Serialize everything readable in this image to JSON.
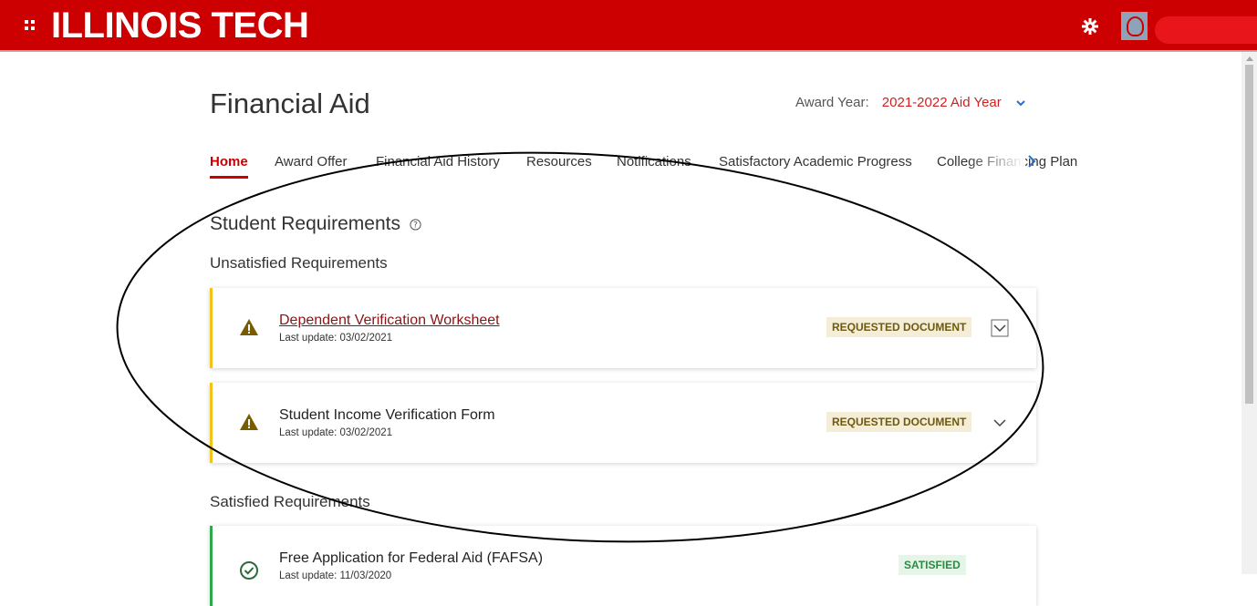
{
  "header": {
    "brand": "ILLINOIS TECH",
    "icons": [
      "apps-icon",
      "gear-icon",
      "avatar"
    ]
  },
  "page": {
    "title": "Financial Aid",
    "award_year_label": "Award Year:",
    "award_year_value": "2021-2022 Aid Year"
  },
  "tabs": [
    {
      "label": "Home",
      "active": true
    },
    {
      "label": "Award Offer"
    },
    {
      "label": "Financial Aid History"
    },
    {
      "label": "Resources"
    },
    {
      "label": "Notifications"
    },
    {
      "label": "Satisfactory Academic Progress"
    },
    {
      "label": "College Financing Plan"
    }
  ],
  "requirements": {
    "heading": "Student Requirements",
    "unsatisfied_heading": "Unsatisfied Requirements",
    "satisfied_heading": "Satisfied Requirements",
    "unsatisfied": [
      {
        "title": "Dependent Verification Worksheet",
        "date": "Last update: 03/02/2021",
        "status": "REQUESTED DOCUMENT"
      },
      {
        "title": "Student Income Verification Form",
        "date": "Last update: 03/02/2021",
        "status": "REQUESTED DOCUMENT"
      }
    ],
    "satisfied": [
      {
        "title": "Free Application for Federal Aid (FAFSA)",
        "date": "Last update: 11/03/2020",
        "status": "SATISFIED"
      }
    ]
  },
  "colors": {
    "brand_red": "#cc0000",
    "warning_yellow": "#f0c419",
    "success_green": "#2eaa4c"
  }
}
